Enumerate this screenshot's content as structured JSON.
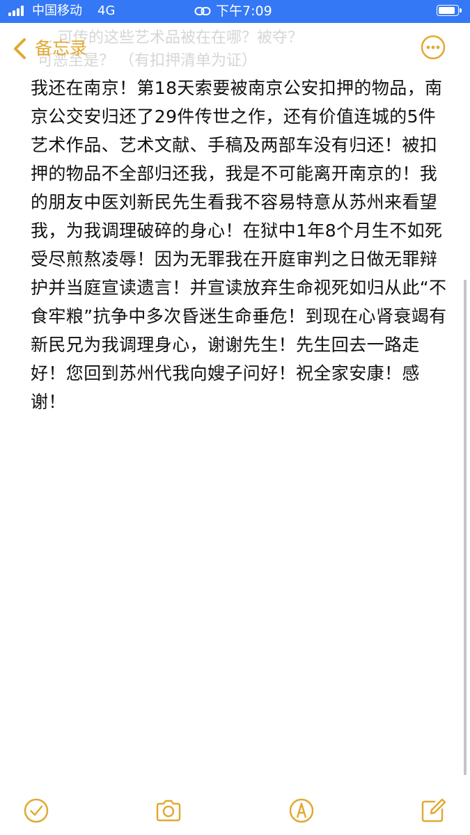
{
  "status_bar": {
    "carrier": "中国移动",
    "network": "4G",
    "time": "下午7:09",
    "signal_bars": 4,
    "battery_level": 0.95,
    "background_color": "#3478f6"
  },
  "header": {
    "back_label": "备忘录",
    "back_icon": "chevron-left-icon",
    "more_icon": "more-ellipsis-icon",
    "ghost_text": "… 可传的这些艺术品被在在哪？被夺？\n可恶至是？ （有扣押清单为证）",
    "accent_color": "#e1a931"
  },
  "note": {
    "body": " 我还在南京！第18天索要被南京公安扣押的物品，南京公交安归还了29件传世之作，还有价值连城的5件艺术作品、艺术文献、手稿及两部车没有归还！被扣押的物品不全部归还我，我是不可能离开南京的！我的朋友中医刘新民先生看我不容易特意从苏州来看望我，为我调理破碎的身心！在狱中1年8个月生不如死受尽煎熬凌辱！因为无罪我在开庭审判之日做无罪辩护并当庭宣读遗言！并宣读放弃生命视死如归从此“不食牢粮”抗争中多次昏迷生命垂危！到现在心肾衰竭有新民兄为我调理身心，谢谢先生！先生回去一路走好！您回到苏州代我向嫂子问好！祝全家安康！感谢！"
  },
  "toolbar": {
    "items": [
      {
        "icon": "checklist-icon"
      },
      {
        "icon": "camera-icon"
      },
      {
        "icon": "markup-pen-icon"
      },
      {
        "icon": "compose-icon"
      }
    ]
  }
}
